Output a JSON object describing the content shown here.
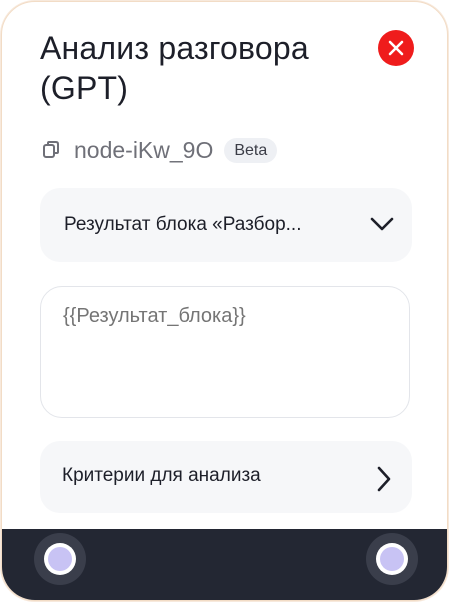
{
  "node": {
    "title": "Анализ разговора (GPT)",
    "id": "node-iKw_9O",
    "badge": "Beta"
  },
  "result_select": {
    "label": "Результат блока «Разбор..."
  },
  "input": {
    "placeholder": "{{Результат_блока}}",
    "value": ""
  },
  "criteria": {
    "label": "Критерии для анализа"
  },
  "colors": {
    "close": "#ef1c1c",
    "footer": "#232733",
    "port_fill": "#c8c3f4",
    "panel": "#f6f7f9"
  },
  "icons": {
    "close": "close-icon",
    "copy": "copy-icon",
    "dropdown": "chevron-down-icon",
    "next": "chevron-right-icon"
  }
}
